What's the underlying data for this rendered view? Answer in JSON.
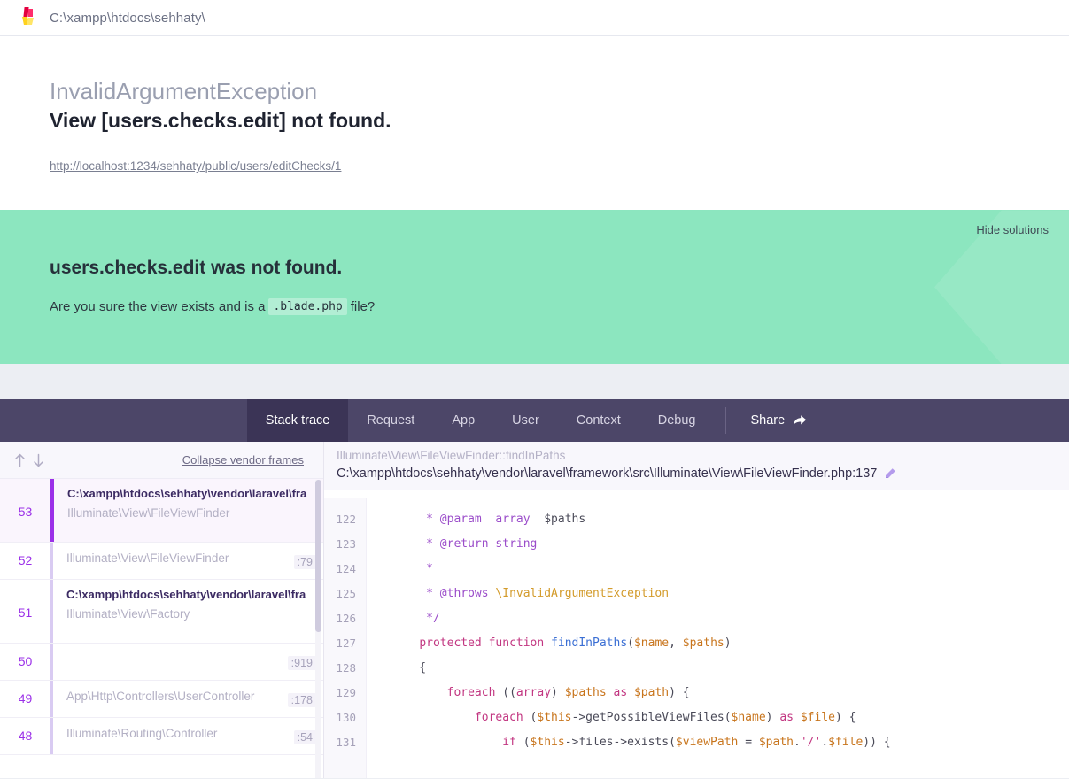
{
  "urlbar": {
    "path": "C:\\xampp\\htdocs\\sehhaty\\",
    "logo_icon": "flare-logo-icon"
  },
  "exception": {
    "class": "InvalidArgumentException",
    "message": "View [users.checks.edit] not found.",
    "url": "http://localhost:1234/sehhaty/public/users/editChecks/1"
  },
  "solutions": {
    "hide_label": "Hide solutions",
    "title": "users.checks.edit was not found.",
    "body_before": "Are you sure the view exists and is a",
    "body_code": ".blade.php",
    "body_after": "file?",
    "background": "#8ce6bf"
  },
  "tabs": [
    {
      "label": "Stack trace",
      "active": true
    },
    {
      "label": "Request",
      "active": false
    },
    {
      "label": "App",
      "active": false
    },
    {
      "label": "User",
      "active": false
    },
    {
      "label": "Context",
      "active": false
    },
    {
      "label": "Debug",
      "active": false
    }
  ],
  "share": {
    "label": "Share",
    "icon": "share-arrow-icon"
  },
  "stack_toolbar": {
    "sort_up_icon": "arrow-up-icon",
    "sort_down_icon": "arrow-down-icon",
    "collapse_label": "Collapse vendor frames"
  },
  "frames": [
    {
      "number": "53",
      "path": "C:\\xampp\\htdocs\\sehhaty\\vendor\\laravel\\fra",
      "class": "Illuminate\\View\\FileViewFinder",
      "line": "",
      "selected": true,
      "tall": true
    },
    {
      "number": "52",
      "path": "",
      "class": "Illuminate\\View\\FileViewFinder",
      "line": ":79",
      "selected": false,
      "tall": false
    },
    {
      "number": "51",
      "path": "C:\\xampp\\htdocs\\sehhaty\\vendor\\laravel\\fra",
      "class": "Illuminate\\View\\Factory",
      "line": "",
      "selected": false,
      "tall": true
    },
    {
      "number": "50",
      "path": "",
      "class": "",
      "line": ":919",
      "selected": false,
      "tall": false
    },
    {
      "number": "49",
      "path": "",
      "class": "App\\Http\\Controllers\\UserController",
      "line": ":178",
      "selected": false,
      "tall": false
    },
    {
      "number": "48",
      "path": "",
      "class": "Illuminate\\Routing\\Controller",
      "line": ":54",
      "selected": false,
      "tall": false
    }
  ],
  "code_header": {
    "function": "Illuminate\\View\\FileViewFinder::findInPaths",
    "file": "C:\\xampp\\htdocs\\sehhaty\\vendor\\laravel\\framework\\src\\Illuminate\\View\\FileViewFinder.php:137",
    "edit_icon": "pencil-icon"
  },
  "code": {
    "line_numbers": [
      "122",
      "123",
      "124",
      "125",
      "126",
      "127",
      "128",
      "129",
      "130",
      "131"
    ],
    "lines": [
      [
        {
          "t": "     * ",
          "c": "cm"
        },
        {
          "t": "@param",
          "c": "cm"
        },
        {
          "t": "  ",
          "c": "pl"
        },
        {
          "t": "array",
          "c": "ty"
        },
        {
          "t": "  ",
          "c": "pl"
        },
        {
          "t": "$paths",
          "c": "pl"
        }
      ],
      [
        {
          "t": "     * ",
          "c": "cm"
        },
        {
          "t": "@return",
          "c": "cm"
        },
        {
          "t": " ",
          "c": "pl"
        },
        {
          "t": "string",
          "c": "ty"
        }
      ],
      [
        {
          "t": "     *",
          "c": "cm"
        }
      ],
      [
        {
          "t": "     * ",
          "c": "cm"
        },
        {
          "t": "@throws",
          "c": "cm"
        },
        {
          "t": " ",
          "c": "pl"
        },
        {
          "t": "\\InvalidArgumentException",
          "c": "cl"
        }
      ],
      [
        {
          "t": "     */",
          "c": "cm"
        }
      ],
      [
        {
          "t": "    ",
          "c": "pl"
        },
        {
          "t": "protected",
          "c": "k"
        },
        {
          "t": " ",
          "c": "pl"
        },
        {
          "t": "function",
          "c": "k"
        },
        {
          "t": " ",
          "c": "pl"
        },
        {
          "t": "findInPaths",
          "c": "fn"
        },
        {
          "t": "(",
          "c": "pl"
        },
        {
          "t": "$name",
          "c": "v"
        },
        {
          "t": ", ",
          "c": "pl"
        },
        {
          "t": "$paths",
          "c": "v"
        },
        {
          "t": ")",
          "c": "pl"
        }
      ],
      [
        {
          "t": "    {",
          "c": "pl"
        }
      ],
      [
        {
          "t": "        ",
          "c": "pl"
        },
        {
          "t": "foreach",
          "c": "k"
        },
        {
          "t": " ((",
          "c": "pl"
        },
        {
          "t": "array",
          "c": "k"
        },
        {
          "t": ") ",
          "c": "pl"
        },
        {
          "t": "$paths",
          "c": "v"
        },
        {
          "t": " ",
          "c": "pl"
        },
        {
          "t": "as",
          "c": "k"
        },
        {
          "t": " ",
          "c": "pl"
        },
        {
          "t": "$path",
          "c": "v"
        },
        {
          "t": ") {",
          "c": "pl"
        }
      ],
      [
        {
          "t": "            ",
          "c": "pl"
        },
        {
          "t": "foreach",
          "c": "k"
        },
        {
          "t": " (",
          "c": "pl"
        },
        {
          "t": "$this",
          "c": "v"
        },
        {
          "t": "->getPossibleViewFiles(",
          "c": "pl"
        },
        {
          "t": "$name",
          "c": "v"
        },
        {
          "t": ") ",
          "c": "pl"
        },
        {
          "t": "as",
          "c": "k"
        },
        {
          "t": " ",
          "c": "pl"
        },
        {
          "t": "$file",
          "c": "v"
        },
        {
          "t": ") {",
          "c": "pl"
        }
      ],
      [
        {
          "t": "                ",
          "c": "pl"
        },
        {
          "t": "if",
          "c": "k"
        },
        {
          "t": " (",
          "c": "pl"
        },
        {
          "t": "$this",
          "c": "v"
        },
        {
          "t": "->files->exists(",
          "c": "pl"
        },
        {
          "t": "$viewPath",
          "c": "v"
        },
        {
          "t": " = ",
          "c": "pl"
        },
        {
          "t": "$path",
          "c": "v"
        },
        {
          "t": ".",
          "c": "pl"
        },
        {
          "t": "'/'",
          "c": "st"
        },
        {
          "t": ".",
          "c": "pl"
        },
        {
          "t": "$file",
          "c": "v"
        },
        {
          "t": ")) {",
          "c": "pl"
        }
      ]
    ]
  }
}
